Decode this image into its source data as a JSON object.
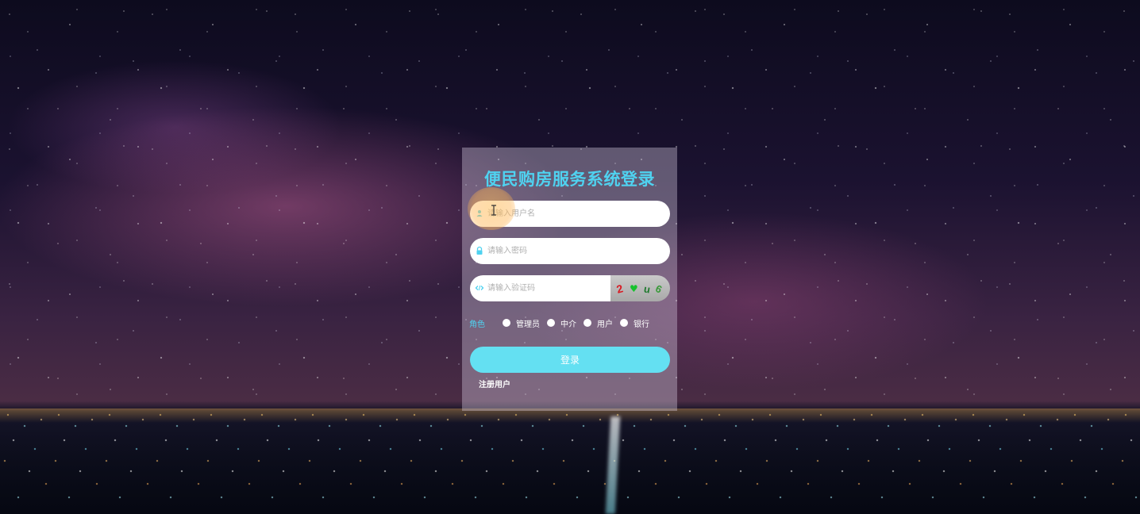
{
  "login": {
    "title": "便民购房服务系统登录",
    "username_placeholder": "请输入用户名",
    "password_placeholder": "请输入密码",
    "captcha_placeholder": "请输入验证码",
    "captcha_chars": [
      "2",
      "♥",
      "u",
      "6"
    ],
    "role_label": "角色",
    "roles": [
      "管理员",
      "中介",
      "用户",
      "银行"
    ],
    "login_label": "登录",
    "register_label": "注册用户"
  },
  "colors": {
    "accent": "#4fd2f0",
    "button": "#64e0f2",
    "panel": "rgba(215,205,225,0.38)"
  },
  "icons": {
    "username": "user-icon",
    "password": "lock-icon",
    "captcha": "code-icon"
  }
}
